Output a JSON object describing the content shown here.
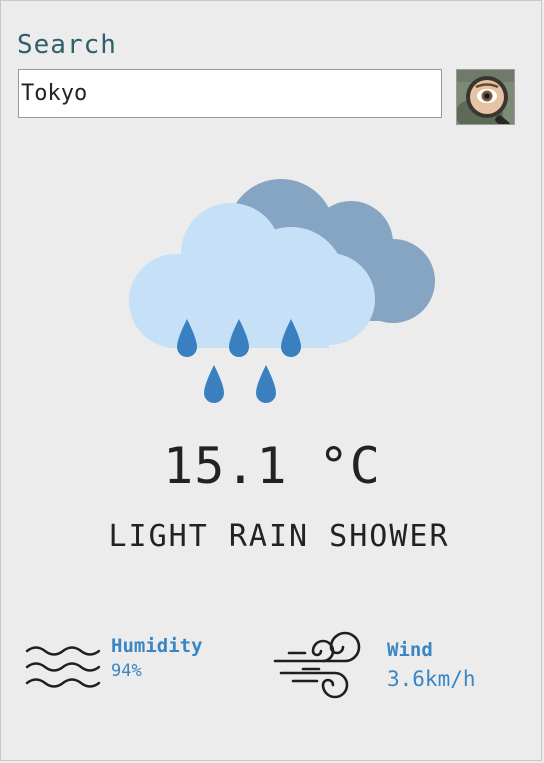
{
  "search": {
    "label": "Search",
    "value": "Tokyo",
    "button_icon": "magnifying-glass-eye-icon"
  },
  "weather": {
    "icon": "cloud-rain-shower-icon",
    "temperature": "15.1 °C",
    "condition": "LIGHT RAIN SHOWER"
  },
  "humidity": {
    "icon": "waves-icon",
    "label": "Humidity",
    "value": "94%"
  },
  "wind": {
    "icon": "wind-icon",
    "label": "Wind",
    "value": "3.6km/h"
  },
  "colors": {
    "background": "#ececec",
    "accent": "#3a86c4",
    "label": "#2e5f6a",
    "cloud_front": "#c6e0f7",
    "cloud_back": "#86a5c3",
    "rain": "#3a80c0"
  }
}
